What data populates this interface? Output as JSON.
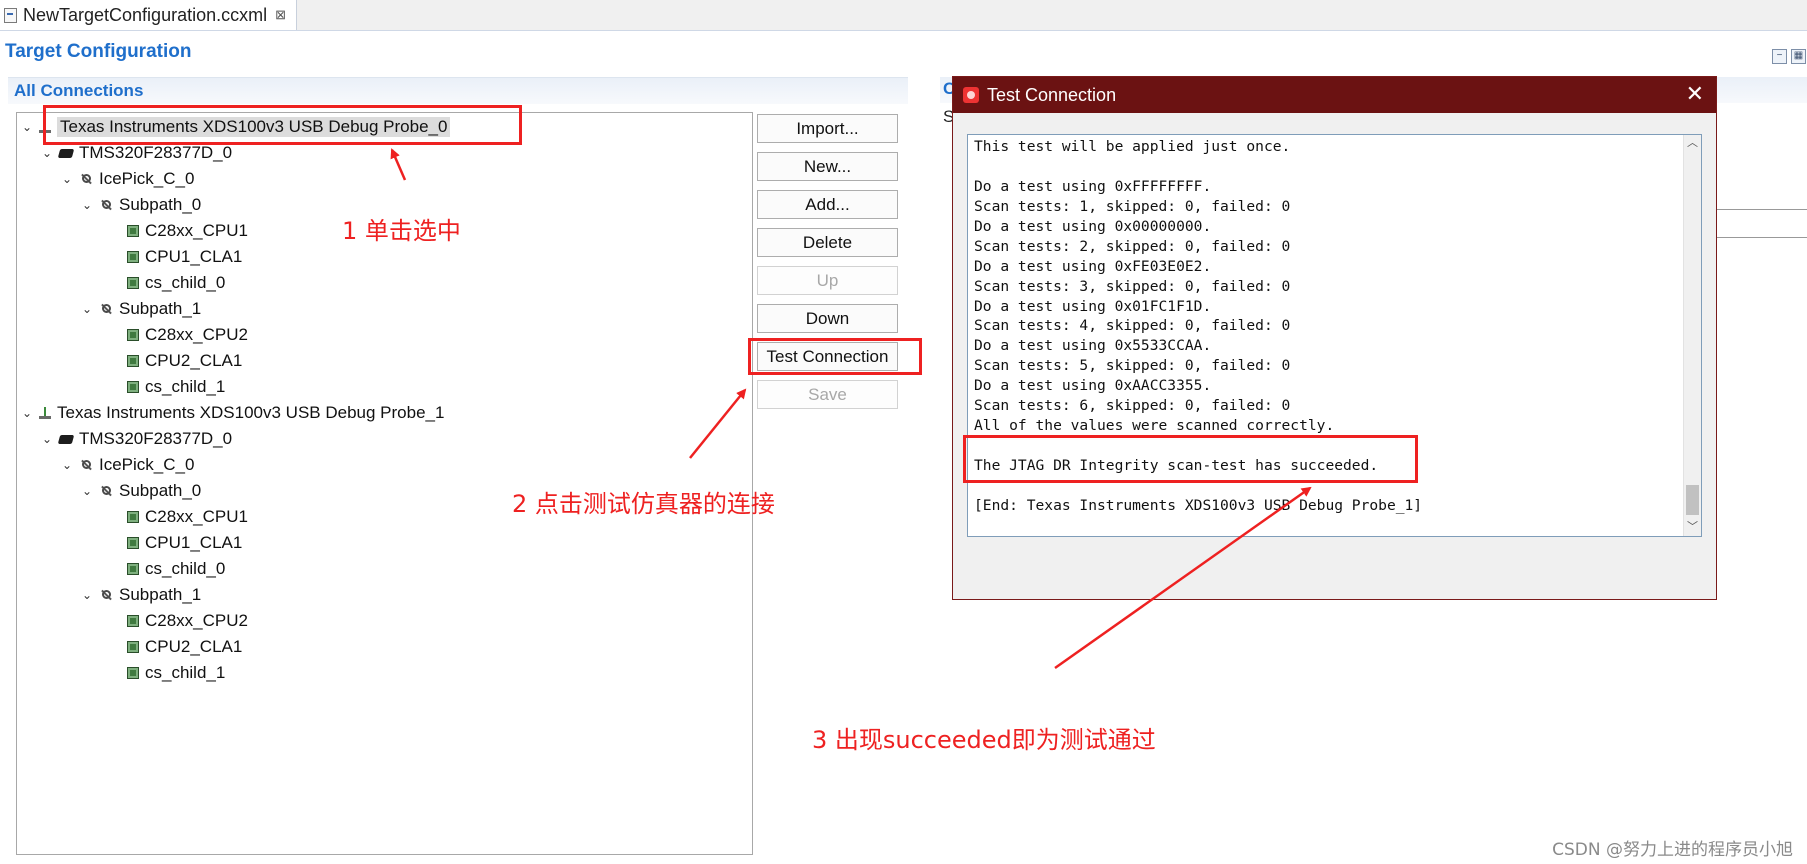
{
  "editor_tab": {
    "title": "NewTargetConfiguration.ccxml",
    "close": "⊠"
  },
  "heading": "Target Configuration",
  "section_title": "All Connections",
  "tree": [
    {
      "label": "Texas Instruments XDS100v3 USB Debug Probe_0",
      "level": 0,
      "icon": "probe-icon",
      "selected": true
    },
    {
      "label": "TMS320F28377D_0",
      "level": 1,
      "icon": "device-icon"
    },
    {
      "label": "IcePick_C_0",
      "level": 2,
      "icon": "router-icon"
    },
    {
      "label": "Subpath_0",
      "level": 3,
      "icon": "router-icon"
    },
    {
      "label": "C28xx_CPU1",
      "level": 4,
      "icon": "core-icon"
    },
    {
      "label": "CPU1_CLA1",
      "level": 4,
      "icon": "core-icon"
    },
    {
      "label": "cs_child_0",
      "level": 4,
      "icon": "core-icon"
    },
    {
      "label": "Subpath_1",
      "level": 3,
      "icon": "router-icon"
    },
    {
      "label": "C28xx_CPU2",
      "level": 4,
      "icon": "core-icon"
    },
    {
      "label": "CPU2_CLA1",
      "level": 4,
      "icon": "core-icon"
    },
    {
      "label": "cs_child_1",
      "level": 4,
      "icon": "core-icon"
    },
    {
      "label": "Texas Instruments XDS100v3 USB Debug Probe_1",
      "level": 0,
      "icon": "probe-icon"
    },
    {
      "label": "TMS320F28377D_0",
      "level": 1,
      "icon": "device-icon"
    },
    {
      "label": "IcePick_C_0",
      "level": 2,
      "icon": "router-icon"
    },
    {
      "label": "Subpath_0",
      "level": 3,
      "icon": "router-icon"
    },
    {
      "label": "C28xx_CPU1",
      "level": 4,
      "icon": "core-icon"
    },
    {
      "label": "CPU1_CLA1",
      "level": 4,
      "icon": "core-icon"
    },
    {
      "label": "cs_child_0",
      "level": 4,
      "icon": "core-icon"
    },
    {
      "label": "Subpath_1",
      "level": 3,
      "icon": "router-icon"
    },
    {
      "label": "C28xx_CPU2",
      "level": 4,
      "icon": "core-icon"
    },
    {
      "label": "CPU2_CLA1",
      "level": 4,
      "icon": "core-icon"
    },
    {
      "label": "cs_child_1",
      "level": 4,
      "icon": "core-icon"
    }
  ],
  "buttons": {
    "import": "Import...",
    "new": "New...",
    "add": "Add...",
    "delete": "Delete",
    "up": "Up",
    "down": "Down",
    "test_connection": "Test Connection",
    "save": "Save"
  },
  "dialog": {
    "title": "Test Connection",
    "close": "✕",
    "log": [
      "This test will be applied just once.",
      "",
      "Do a test using 0xFFFFFFFF.",
      "Scan tests: 1, skipped: 0, failed: 0",
      "Do a test using 0x00000000.",
      "Scan tests: 2, skipped: 0, failed: 0",
      "Do a test using 0xFE03E0E2.",
      "Scan tests: 3, skipped: 0, failed: 0",
      "Do a test using 0x01FC1F1D.",
      "Scan tests: 4, skipped: 0, failed: 0",
      "Do a test using 0x5533CCAA.",
      "Scan tests: 5, skipped: 0, failed: 0",
      "Do a test using 0xAACC3355.",
      "Scan tests: 6, skipped: 0, failed: 0",
      "All of the values were scanned correctly.",
      "",
      "The JTAG DR Integrity scan-test has succeeded.",
      "",
      "[End: Texas Instruments XDS100v3 USB Debug Probe_1]"
    ]
  },
  "background_panel": {
    "c": "C",
    "s": "S"
  },
  "annotations": {
    "step1": "1 单击选中",
    "step2": "2 点击测试仿真器的连接",
    "step3": "3 出现succeeded即为测试通过"
  },
  "watermark": "CSDN @努力上进的程序员小旭",
  "colors": {
    "accent": "#1f6fcb",
    "annotation": "#ee2121",
    "dialog_title_bg": "#6b1212"
  }
}
